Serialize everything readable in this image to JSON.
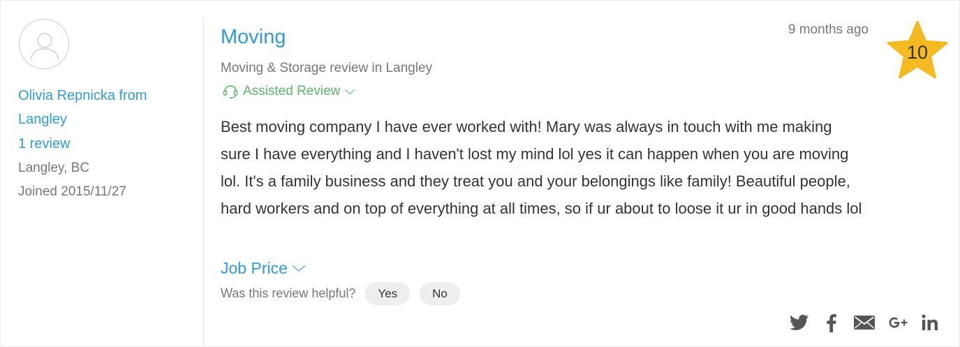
{
  "reviewer": {
    "name": "Olivia Repnicka from Langley",
    "review_count": "1 review",
    "location": "Langley, BC",
    "joined": "Joined 2015/11/27"
  },
  "review": {
    "title": "Moving",
    "time_ago": "9 months ago",
    "rating": "10",
    "category": "Moving & Storage review in Langley",
    "assisted_label": "Assisted Review",
    "body": "Best moving company I have ever worked with! Mary was always in touch with me making sure I have everything and I haven't lost my mind lol yes it can happen when you are moving lol. It's a family business and they treat you and your belongings like family! Beautiful people, hard workers and on top of everything at all times, so if ur about to loose it ur in good hands lol",
    "job_price_label": "Job Price",
    "helpful_question": "Was this review helpful?",
    "yes_label": "Yes",
    "no_label": "No"
  },
  "share_icons": [
    "twitter-icon",
    "facebook-icon",
    "email-icon",
    "google-plus-icon",
    "linkedin-icon"
  ],
  "colors": {
    "link": "#2f9bdb",
    "muted": "#777777",
    "assisted": "#59b866",
    "star": "#f5b921",
    "pill": "#eeeeee",
    "icon": "#555555"
  }
}
